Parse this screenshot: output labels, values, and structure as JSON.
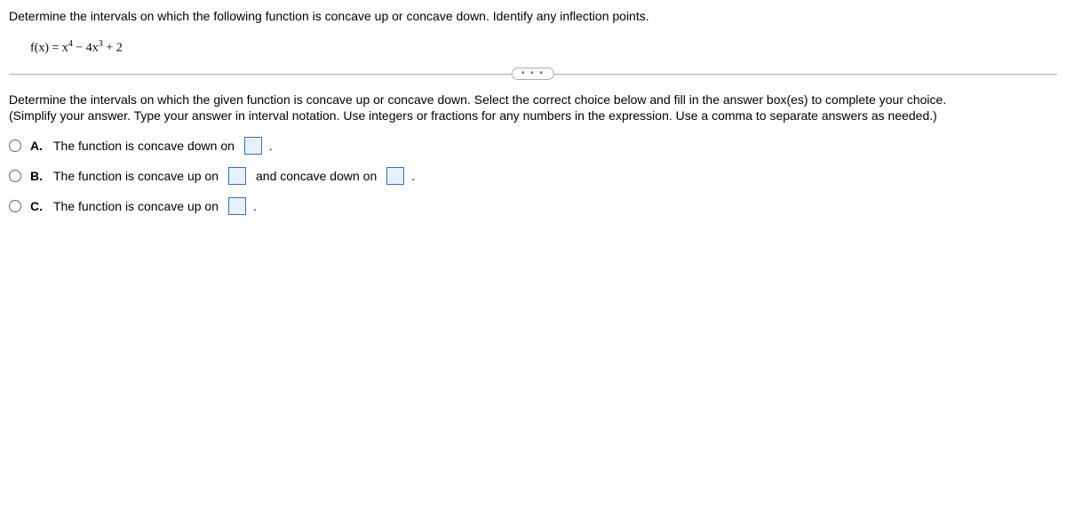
{
  "question": {
    "prompt": "Determine the intervals on which the following function is concave up or concave down. Identify any inflection points.",
    "formula_prefix": "f(x) = x",
    "formula_exp1": "4",
    "formula_mid": " − 4x",
    "formula_exp2": "3",
    "formula_suffix": " + 2"
  },
  "divider": {
    "dots": "• • •"
  },
  "instructions": {
    "line1": "Determine the intervals on which the given function is concave up or concave down. Select the correct choice below and fill in the answer box(es) to complete your choice.",
    "line2": "(Simplify your answer. Type your answer in interval notation. Use integers or fractions for any numbers in the expression. Use a comma to separate answers as needed.)"
  },
  "choices": {
    "a": {
      "label": "A.",
      "text1": "The function is concave down on",
      "period": "."
    },
    "b": {
      "label": "B.",
      "text1": "The function is concave up on",
      "text2": "and concave down on",
      "period": "."
    },
    "c": {
      "label": "C.",
      "text1": "The function is concave up on",
      "period": "."
    }
  }
}
